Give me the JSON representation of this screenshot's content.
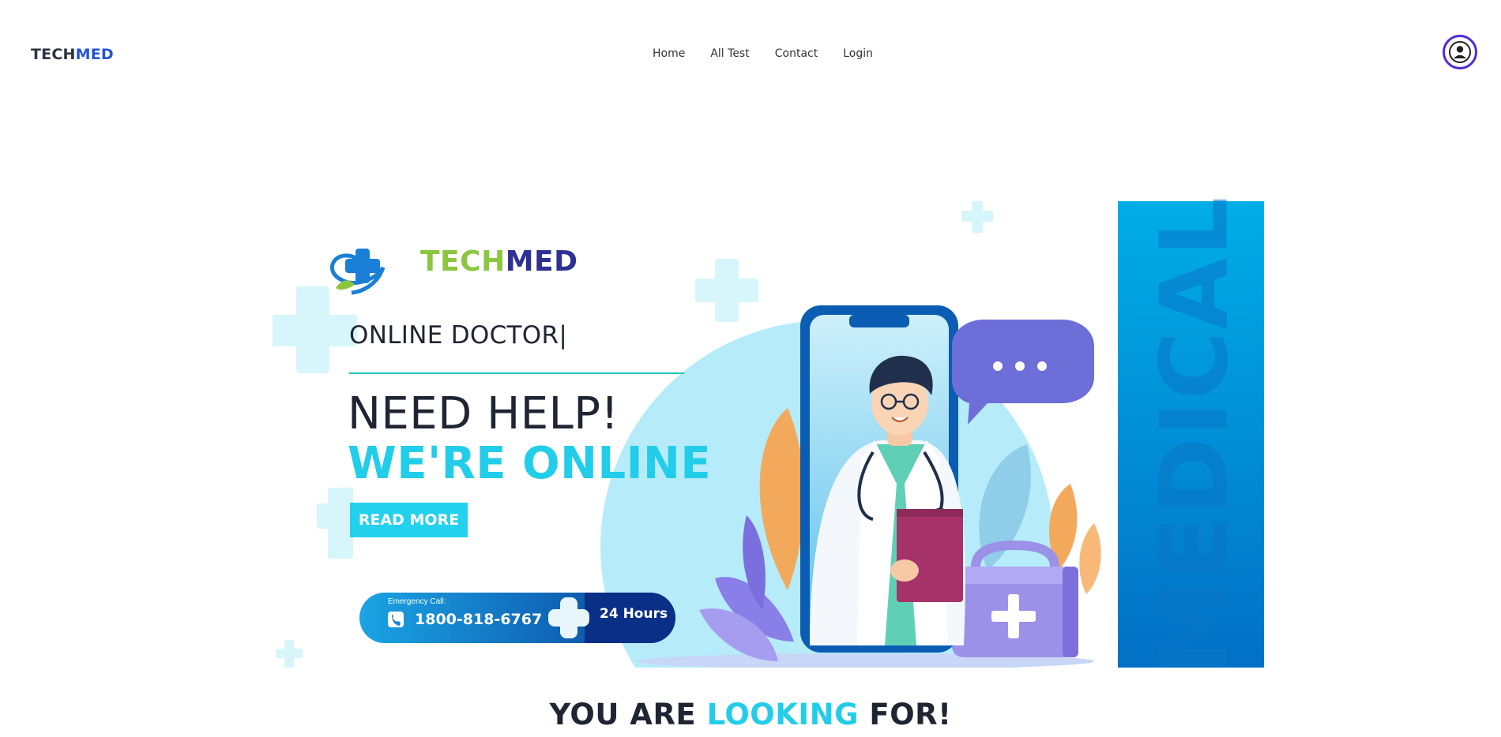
{
  "navbar": {
    "brand_part1": "TECH",
    "brand_part2": "MED",
    "menu": [
      "Home",
      "All Test",
      "Contact",
      "Login"
    ]
  },
  "hero": {
    "logo_part1": "TECH",
    "logo_part2": "MED",
    "subtitle": "ONLINE DOCTOR|",
    "headline_line1": "NEED HELP!",
    "headline_line2": "WE'RE ONLINE",
    "button_label": "READ MORE",
    "emergency_label": "Emergency Call:",
    "emergency_phone": "1800-818-6767",
    "emergency_hours": "24 Hours",
    "vertical_word": "MEDICAL"
  },
  "section": {
    "title_part1": "YOU ARE ",
    "title_highlight": "LOOKING",
    "title_part2": " FOR!"
  },
  "colors": {
    "accent": "#22cde9",
    "brand_blue": "#2453d6",
    "brand_green": "#8cc63f",
    "avatar_ring": "#4f2bd8"
  },
  "icons": {
    "user": "user-circle-icon",
    "phone": "phone-icon",
    "medical_cross": "medical-cross-icon"
  }
}
